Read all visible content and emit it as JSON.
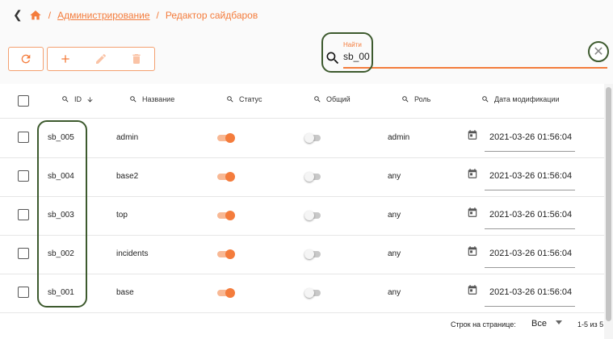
{
  "breadcrumb": {
    "back_icon": "chevron-left-icon",
    "home_icon": "home-icon",
    "separator": "/",
    "admin": "Администрирование",
    "current": "Редактор сайдбаров"
  },
  "toolbar": {
    "refresh_icon": "refresh-icon",
    "add_icon": "plus-icon",
    "edit_icon": "pencil-icon",
    "delete_icon": "trash-icon"
  },
  "search": {
    "label": "Найти",
    "value": "sb_00"
  },
  "columns": {
    "id": "ID",
    "name": "Название",
    "status": "Статус",
    "shared": "Общий",
    "role": "Роль",
    "modified": "Дата модификации"
  },
  "rows": [
    {
      "id": "sb_005",
      "name": "admin",
      "status": true,
      "shared": false,
      "role": "admin",
      "modified": "2021-03-26 01:56:04"
    },
    {
      "id": "sb_004",
      "name": "base2",
      "status": true,
      "shared": false,
      "role": "any",
      "modified": "2021-03-26 01:56:04"
    },
    {
      "id": "sb_003",
      "name": "top",
      "status": true,
      "shared": false,
      "role": "any",
      "modified": "2021-03-26 01:56:04"
    },
    {
      "id": "sb_002",
      "name": "incidents",
      "status": true,
      "shared": false,
      "role": "any",
      "modified": "2021-03-26 01:56:04"
    },
    {
      "id": "sb_001",
      "name": "base",
      "status": true,
      "shared": false,
      "role": "any",
      "modified": "2021-03-26 01:56:04"
    }
  ],
  "footer": {
    "rows_per_page_label": "Строк на странице:",
    "rows_per_page_value": "Все",
    "range": "1-5 из 5"
  },
  "colors": {
    "accent": "#f47c3c",
    "highlight": "#3d5a2e"
  }
}
